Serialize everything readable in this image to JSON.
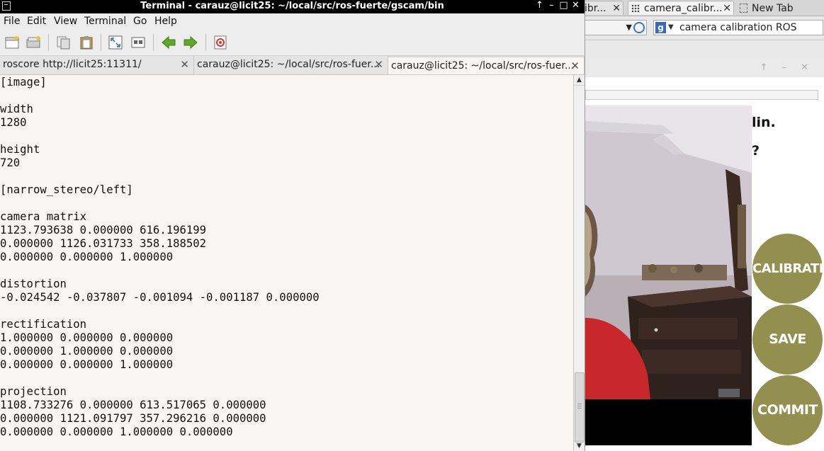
{
  "terminal": {
    "title": "Terminal - carauz@licit25: ~/local/src/ros-fuerte/gscam/bin",
    "window_controls": [
      "↑",
      "–",
      "□",
      "✕"
    ],
    "menu": [
      {
        "label": "File"
      },
      {
        "label": "Edit"
      },
      {
        "label": "View"
      },
      {
        "label": "Terminal"
      },
      {
        "label": "Go"
      },
      {
        "label": "Help"
      }
    ],
    "tabs": [
      {
        "label": "roscore http://licit25:11311/"
      },
      {
        "label": "carauz@licit25: ~/local/src/ros-fuer..."
      },
      {
        "label": "carauz@licit25: ~/local/src/ros-fuer..."
      }
    ],
    "tab_close": "✕",
    "lines": [
      "[image]",
      "",
      "width",
      "1280",
      "",
      "height",
      "720",
      "",
      "[narrow_stereo/left]",
      "",
      "camera matrix",
      "1123.793638 0.000000 616.196199",
      "0.000000 1126.031733 358.188502",
      "0.000000 0.000000 1.000000",
      "",
      "distortion",
      "-0.024542 -0.037807 -0.001094 -0.001187 0.000000",
      "",
      "rectification",
      "1.000000 0.000000 0.000000",
      "0.000000 1.000000 0.000000",
      "0.000000 0.000000 1.000000",
      "",
      "projection",
      "1108.733276 0.000000 613.517065 0.000000",
      "0.000000 1121.091797 357.296216 0.000000",
      "0.000000 0.000000 1.000000 0.000000"
    ]
  },
  "browser": {
    "tabs": [
      {
        "label": "ibr..."
      },
      {
        "label": "camera_calibr..."
      },
      {
        "label": "New Tab"
      }
    ],
    "tab_close": "✕",
    "search_text": "camera calibration ROS",
    "search_engine_letter": "g",
    "inner_controls": "↑ – ✕"
  },
  "calibrator": {
    "text_line1": "lin.",
    "text_line2": "?",
    "buttons": {
      "calibrate": "CALIBRATE",
      "save": "SAVE",
      "commit": "COMMIT"
    }
  },
  "colors": {
    "button_olive": "#93904f",
    "terminal_bg": "#f8f6f4"
  }
}
